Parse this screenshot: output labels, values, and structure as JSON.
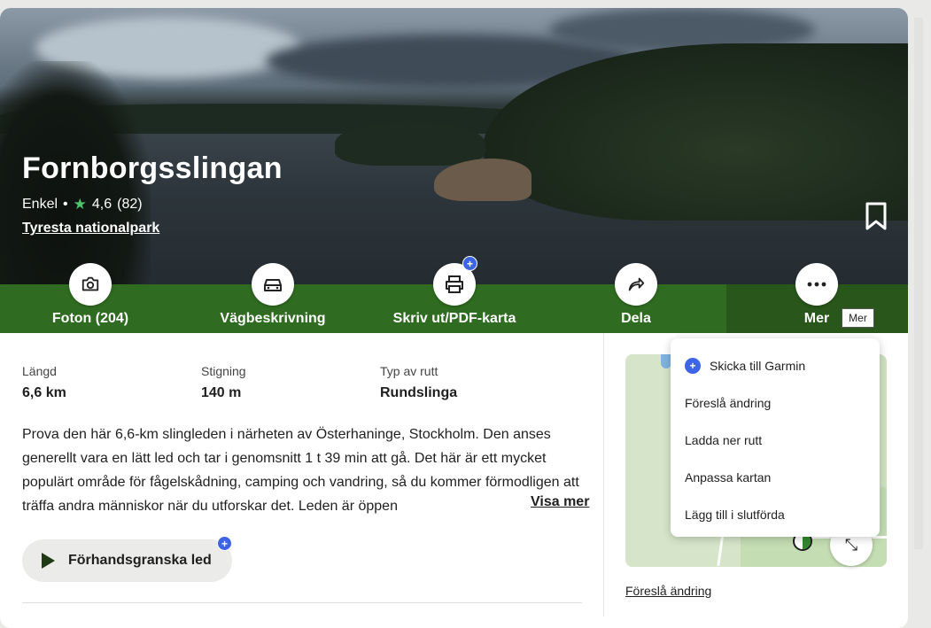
{
  "trail": {
    "title": "Fornborgsslingan",
    "difficulty": "Enkel",
    "bullet": "•",
    "rating": "4,6",
    "reviews": "(82)",
    "park": "Tyresta nationalpark"
  },
  "actions": [
    {
      "label": "Foton (204)",
      "icon": "camera-icon"
    },
    {
      "label": "Vägbeskrivning",
      "icon": "car-icon"
    },
    {
      "label": "Skriv ut/PDF-karta",
      "icon": "printer-icon",
      "badge": "+"
    },
    {
      "label": "Dela",
      "icon": "share-icon"
    },
    {
      "label": "Mer",
      "icon": "more-icon"
    }
  ],
  "tooltip": "Mer",
  "stats": [
    {
      "key": "Längd",
      "value": "6,6 km"
    },
    {
      "key": "Stigning",
      "value": "140 m"
    },
    {
      "key": "Typ av rutt",
      "value": "Rundslinga"
    }
  ],
  "description": "Prova den här 6,6-km slingleden i närheten av Österhaninge, Stockholm. Den anses generellt vara en lätt led och tar i genomsnitt 1 t 39 min att gå. Det här är ett mycket populärt område för fågelskådning, camping och vandring, så du kommer förmodligen att träffa andra människor när du utforskar det. Leden är öppen",
  "visa_mer": "Visa mer",
  "preview_button": "Förhandsgranska led",
  "map": {
    "footer_link": "Föreslå ändring"
  },
  "menu": {
    "items": [
      {
        "label": "Skicka till Garmin",
        "badge": "+"
      },
      {
        "label": "Föreslå ändring"
      },
      {
        "label": "Ladda ner rutt"
      },
      {
        "label": "Anpassa kartan"
      },
      {
        "label": "Lägg till i slutförda"
      }
    ]
  },
  "colors": {
    "action_bar": "#2f6b20",
    "rating_star": "#4fc46a",
    "badge": "#3d64e6"
  }
}
